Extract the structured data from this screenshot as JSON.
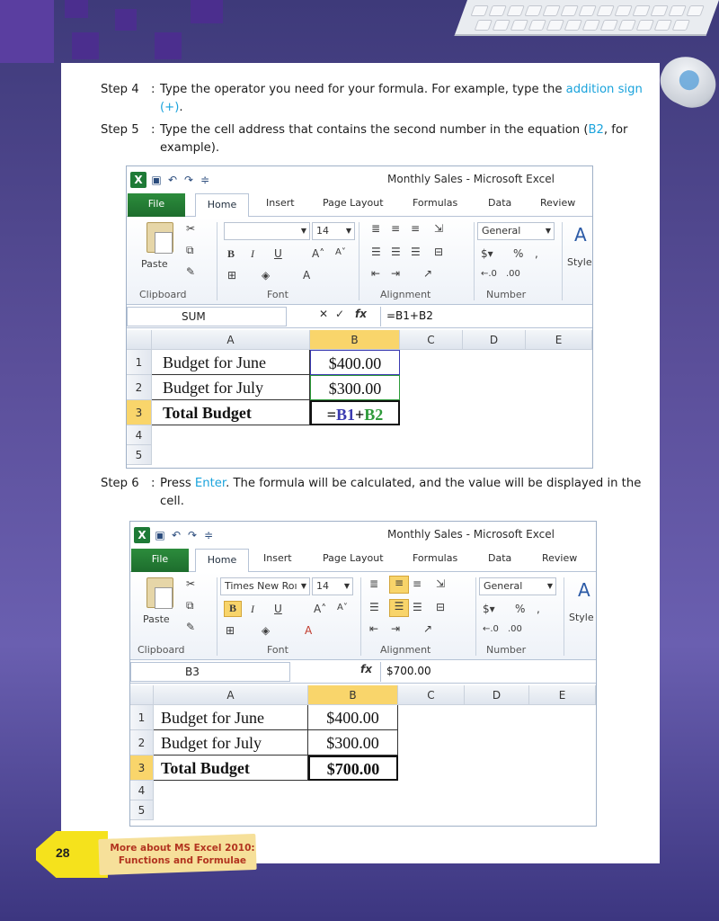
{
  "steps": [
    {
      "label": "Step 4",
      "text_a": "Type the operator you need for your formula. For example, type the ",
      "hl": "addition sign (+)",
      "text_b": "."
    },
    {
      "label": "Step 5",
      "text_a": "Type the cell address that contains the second number in the equation (",
      "hl": "B2",
      "text_b": ", for example)."
    },
    {
      "label": "Step 6",
      "text_a": "Press ",
      "hl": "Enter",
      "text_b": ". The formula will be calculated, and the value will be displayed in the cell."
    }
  ],
  "excel1": {
    "title": "Monthly Sales  -  Microsoft Excel",
    "tabs": {
      "file": "File",
      "home": "Home",
      "insert": "Insert",
      "page_layout": "Page Layout",
      "formulas": "Formulas",
      "data": "Data",
      "review": "Review"
    },
    "font_name": "",
    "font_size": "14",
    "number_format": "General",
    "groups": {
      "clipboard": "Clipboard",
      "font": "Font",
      "alignment": "Alignment",
      "number": "Number"
    },
    "paste": "Paste",
    "style": "Style",
    "name_box": "SUM",
    "formula": "=B1+B2",
    "columns": [
      "A",
      "B",
      "C",
      "D",
      "E"
    ],
    "rows": [
      "1",
      "2",
      "3",
      "4",
      "5"
    ],
    "cells": {
      "a1": "Budget for June",
      "b1": "$400.00",
      "a2": "Budget for July",
      "b2": "$300.00",
      "a3": "Total Budget",
      "b3_prefix": "=",
      "b3_ref1": "B1",
      "b3_op": "+",
      "b3_ref2": "B2"
    }
  },
  "excel2": {
    "title": "Monthly Sales  -  Microsoft Excel",
    "tabs": {
      "file": "File",
      "home": "Home",
      "insert": "Insert",
      "page_layout": "Page Layout",
      "formulas": "Formulas",
      "data": "Data",
      "review": "Review"
    },
    "font_name": "Times New Roı",
    "font_size": "14",
    "number_format": "General",
    "groups": {
      "clipboard": "Clipboard",
      "font": "Font",
      "alignment": "Alignment",
      "number": "Number"
    },
    "paste": "Paste",
    "style": "Style",
    "name_box": "B3",
    "formula": "$700.00",
    "columns": [
      "A",
      "B",
      "C",
      "D",
      "E"
    ],
    "rows": [
      "1",
      "2",
      "3",
      "4",
      "5"
    ],
    "cells": {
      "a1": "Budget for June",
      "b1": "$400.00",
      "a2": "Budget for July",
      "b2": "$300.00",
      "a3": "Total Budget",
      "b3": "$700.00"
    }
  },
  "footer": {
    "page_number": "28",
    "chapter_line1": "More about MS Excel 2010:",
    "chapter_line2": "Functions and Formulae"
  },
  "colors": {
    "highlight": "#1aa3dc",
    "ref1": "#3a3ab0",
    "ref2": "#2e9a3a",
    "excel_green": "#1e7a36",
    "selected_header": "#f9d56b"
  }
}
